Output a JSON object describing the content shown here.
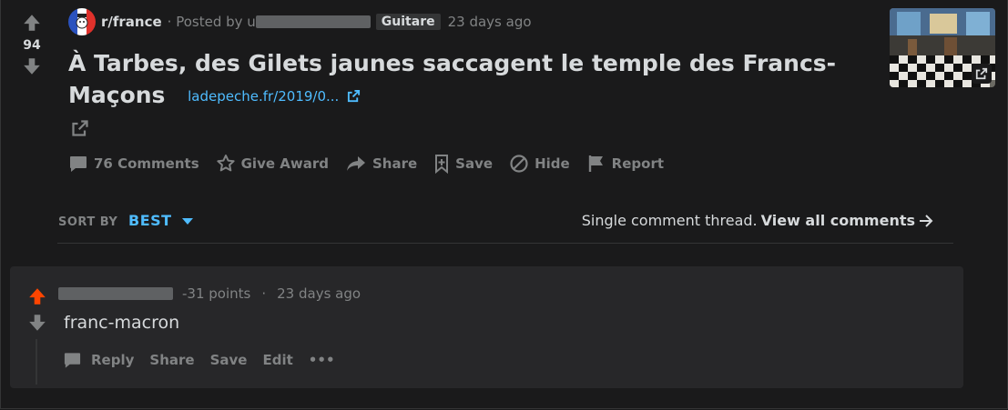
{
  "post": {
    "score": "94",
    "subreddit": "r/france",
    "posted_by": "· Posted by u",
    "flair": "Guitare",
    "time": "23 days ago",
    "title": "À Tarbes, des Gilets jaunes saccagent le temple des Francs-Maçons",
    "domain": "ladepeche.fr/2019/0...",
    "actions": {
      "comments": "76 Comments",
      "award": "Give Award",
      "share": "Share",
      "save": "Save",
      "hide": "Hide",
      "report": "Report"
    }
  },
  "sort": {
    "label": "SORT BY",
    "value": "BEST"
  },
  "thread": {
    "text": "Single comment thread.",
    "link": "View all comments"
  },
  "comment": {
    "points": "-31 points",
    "separator": "·",
    "time": "23 days ago",
    "body": "franc-macron",
    "actions": {
      "reply": "Reply",
      "share": "Share",
      "save": "Save",
      "edit": "Edit",
      "more": "•••"
    }
  },
  "colors": {
    "background": "#1a1a1b",
    "card": "#272729",
    "link": "#4fbcff",
    "upvote_active": "#ff4500",
    "muted": "#818384"
  }
}
